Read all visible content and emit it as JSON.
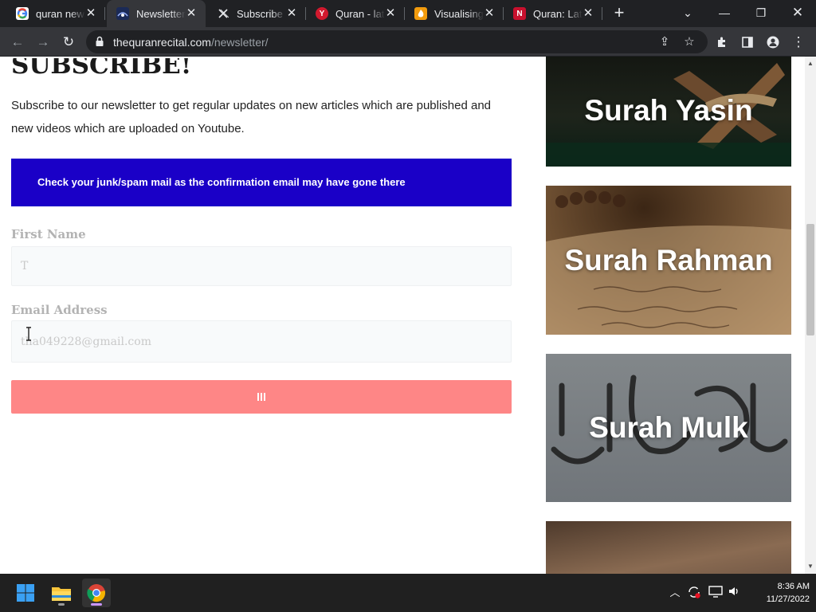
{
  "browser": {
    "tabs": [
      {
        "title": "quran news",
        "favicon": "google-icon"
      },
      {
        "title": "Newsletter",
        "favicon": "site-favicon",
        "active": true
      },
      {
        "title": "Subscribe t",
        "favicon": "x-logo-icon"
      },
      {
        "title": "Quran - late",
        "favicon": "y-favicon"
      },
      {
        "title": "Visualising",
        "favicon": "fire-favicon"
      },
      {
        "title": "Quran: Late",
        "favicon": "n-favicon"
      }
    ],
    "url_host": "thequranrecital.com",
    "url_path": "/newsletter/"
  },
  "page": {
    "heading": "SUBSCRIBE!",
    "intro": "Subscribe to our newsletter to get regular updates on new articles which are published and new videos which are uploaded on Youtube.",
    "notice": "Check your junk/spam mail as the confirmation email may have gone there",
    "form": {
      "first_name_label": "First Name",
      "first_name_value": "T",
      "email_label": "Email Address",
      "email_value": "tha049228@gmail.com"
    },
    "colors": {
      "notice_bg": "#1a00c7",
      "submit_bg": "#fe8686"
    }
  },
  "sidebar": {
    "cards": [
      {
        "title": "Surah Yasin"
      },
      {
        "title": "Surah Rahman"
      },
      {
        "title": "Surah Mulk"
      },
      {
        "title": ""
      }
    ]
  },
  "taskbar": {
    "time": "8:36 AM",
    "date": "11/27/2022"
  }
}
